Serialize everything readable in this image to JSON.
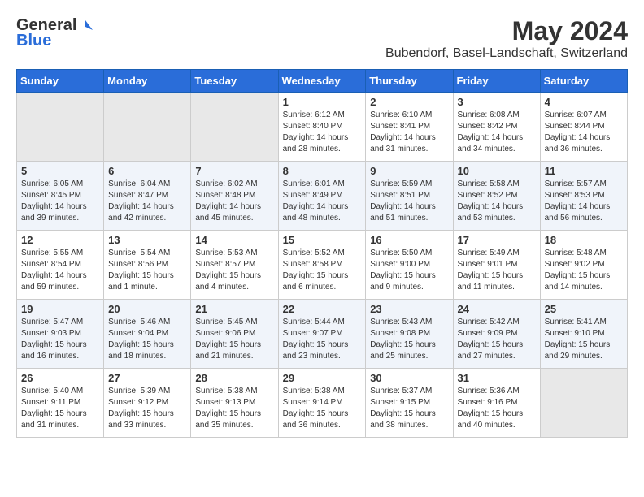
{
  "header": {
    "logo_general": "General",
    "logo_blue": "Blue",
    "month_title": "May 2024",
    "subtitle": "Bubendorf, Basel-Landschaft, Switzerland"
  },
  "weekdays": [
    "Sunday",
    "Monday",
    "Tuesday",
    "Wednesday",
    "Thursday",
    "Friday",
    "Saturday"
  ],
  "weeks": [
    [
      {
        "day": "",
        "info": ""
      },
      {
        "day": "",
        "info": ""
      },
      {
        "day": "",
        "info": ""
      },
      {
        "day": "1",
        "info": "Sunrise: 6:12 AM\nSunset: 8:40 PM\nDaylight: 14 hours\nand 28 minutes."
      },
      {
        "day": "2",
        "info": "Sunrise: 6:10 AM\nSunset: 8:41 PM\nDaylight: 14 hours\nand 31 minutes."
      },
      {
        "day": "3",
        "info": "Sunrise: 6:08 AM\nSunset: 8:42 PM\nDaylight: 14 hours\nand 34 minutes."
      },
      {
        "day": "4",
        "info": "Sunrise: 6:07 AM\nSunset: 8:44 PM\nDaylight: 14 hours\nand 36 minutes."
      }
    ],
    [
      {
        "day": "5",
        "info": "Sunrise: 6:05 AM\nSunset: 8:45 PM\nDaylight: 14 hours\nand 39 minutes."
      },
      {
        "day": "6",
        "info": "Sunrise: 6:04 AM\nSunset: 8:47 PM\nDaylight: 14 hours\nand 42 minutes."
      },
      {
        "day": "7",
        "info": "Sunrise: 6:02 AM\nSunset: 8:48 PM\nDaylight: 14 hours\nand 45 minutes."
      },
      {
        "day": "8",
        "info": "Sunrise: 6:01 AM\nSunset: 8:49 PM\nDaylight: 14 hours\nand 48 minutes."
      },
      {
        "day": "9",
        "info": "Sunrise: 5:59 AM\nSunset: 8:51 PM\nDaylight: 14 hours\nand 51 minutes."
      },
      {
        "day": "10",
        "info": "Sunrise: 5:58 AM\nSunset: 8:52 PM\nDaylight: 14 hours\nand 53 minutes."
      },
      {
        "day": "11",
        "info": "Sunrise: 5:57 AM\nSunset: 8:53 PM\nDaylight: 14 hours\nand 56 minutes."
      }
    ],
    [
      {
        "day": "12",
        "info": "Sunrise: 5:55 AM\nSunset: 8:54 PM\nDaylight: 14 hours\nand 59 minutes."
      },
      {
        "day": "13",
        "info": "Sunrise: 5:54 AM\nSunset: 8:56 PM\nDaylight: 15 hours\nand 1 minute."
      },
      {
        "day": "14",
        "info": "Sunrise: 5:53 AM\nSunset: 8:57 PM\nDaylight: 15 hours\nand 4 minutes."
      },
      {
        "day": "15",
        "info": "Sunrise: 5:52 AM\nSunset: 8:58 PM\nDaylight: 15 hours\nand 6 minutes."
      },
      {
        "day": "16",
        "info": "Sunrise: 5:50 AM\nSunset: 9:00 PM\nDaylight: 15 hours\nand 9 minutes."
      },
      {
        "day": "17",
        "info": "Sunrise: 5:49 AM\nSunset: 9:01 PM\nDaylight: 15 hours\nand 11 minutes."
      },
      {
        "day": "18",
        "info": "Sunrise: 5:48 AM\nSunset: 9:02 PM\nDaylight: 15 hours\nand 14 minutes."
      }
    ],
    [
      {
        "day": "19",
        "info": "Sunrise: 5:47 AM\nSunset: 9:03 PM\nDaylight: 15 hours\nand 16 minutes."
      },
      {
        "day": "20",
        "info": "Sunrise: 5:46 AM\nSunset: 9:04 PM\nDaylight: 15 hours\nand 18 minutes."
      },
      {
        "day": "21",
        "info": "Sunrise: 5:45 AM\nSunset: 9:06 PM\nDaylight: 15 hours\nand 21 minutes."
      },
      {
        "day": "22",
        "info": "Sunrise: 5:44 AM\nSunset: 9:07 PM\nDaylight: 15 hours\nand 23 minutes."
      },
      {
        "day": "23",
        "info": "Sunrise: 5:43 AM\nSunset: 9:08 PM\nDaylight: 15 hours\nand 25 minutes."
      },
      {
        "day": "24",
        "info": "Sunrise: 5:42 AM\nSunset: 9:09 PM\nDaylight: 15 hours\nand 27 minutes."
      },
      {
        "day": "25",
        "info": "Sunrise: 5:41 AM\nSunset: 9:10 PM\nDaylight: 15 hours\nand 29 minutes."
      }
    ],
    [
      {
        "day": "26",
        "info": "Sunrise: 5:40 AM\nSunset: 9:11 PM\nDaylight: 15 hours\nand 31 minutes."
      },
      {
        "day": "27",
        "info": "Sunrise: 5:39 AM\nSunset: 9:12 PM\nDaylight: 15 hours\nand 33 minutes."
      },
      {
        "day": "28",
        "info": "Sunrise: 5:38 AM\nSunset: 9:13 PM\nDaylight: 15 hours\nand 35 minutes."
      },
      {
        "day": "29",
        "info": "Sunrise: 5:38 AM\nSunset: 9:14 PM\nDaylight: 15 hours\nand 36 minutes."
      },
      {
        "day": "30",
        "info": "Sunrise: 5:37 AM\nSunset: 9:15 PM\nDaylight: 15 hours\nand 38 minutes."
      },
      {
        "day": "31",
        "info": "Sunrise: 5:36 AM\nSunset: 9:16 PM\nDaylight: 15 hours\nand 40 minutes."
      },
      {
        "day": "",
        "info": ""
      }
    ]
  ]
}
